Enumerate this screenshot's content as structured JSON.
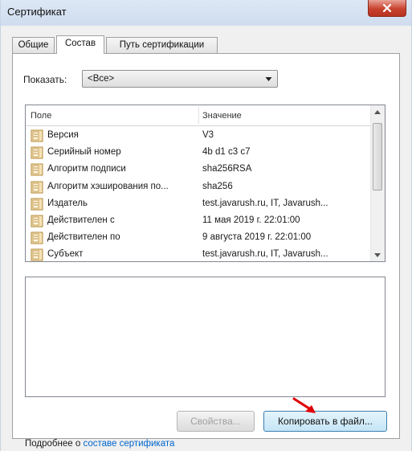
{
  "window": {
    "title": "Сертификат"
  },
  "tabs": [
    {
      "label": "Общие",
      "active": false
    },
    {
      "label": "Состав",
      "active": true
    },
    {
      "label": "Путь сертификации",
      "active": false
    }
  ],
  "show": {
    "label": "Показать:",
    "selected": "<Все>"
  },
  "list": {
    "columns": [
      "Поле",
      "Значение"
    ],
    "rows": [
      {
        "field": "Версия",
        "value": "V3"
      },
      {
        "field": "Серийный номер",
        "value": "4b d1 c3 c7"
      },
      {
        "field": "Алгоритм подписи",
        "value": "sha256RSA"
      },
      {
        "field": "Алгоритм хэширования по...",
        "value": "sha256"
      },
      {
        "field": "Издатель",
        "value": "test.javarush.ru, IT, Javarush..."
      },
      {
        "field": "Действителен с",
        "value": "11 мая 2019 г. 22:01:00"
      },
      {
        "field": "Действителен по",
        "value": "9 августа 2019 г. 22:01:00"
      },
      {
        "field": "Субъект",
        "value": "test.javarush.ru, IT, Javarush..."
      }
    ]
  },
  "buttons": {
    "properties": "Свойства...",
    "copy_to_file": "Копировать в файл..."
  },
  "footer": {
    "prefix": "Подробнее о ",
    "link": "составе сертификата"
  },
  "colors": {
    "accent_button": "#c4e5f6",
    "link": "#0066cc",
    "annotation_arrow": "#e00000"
  }
}
